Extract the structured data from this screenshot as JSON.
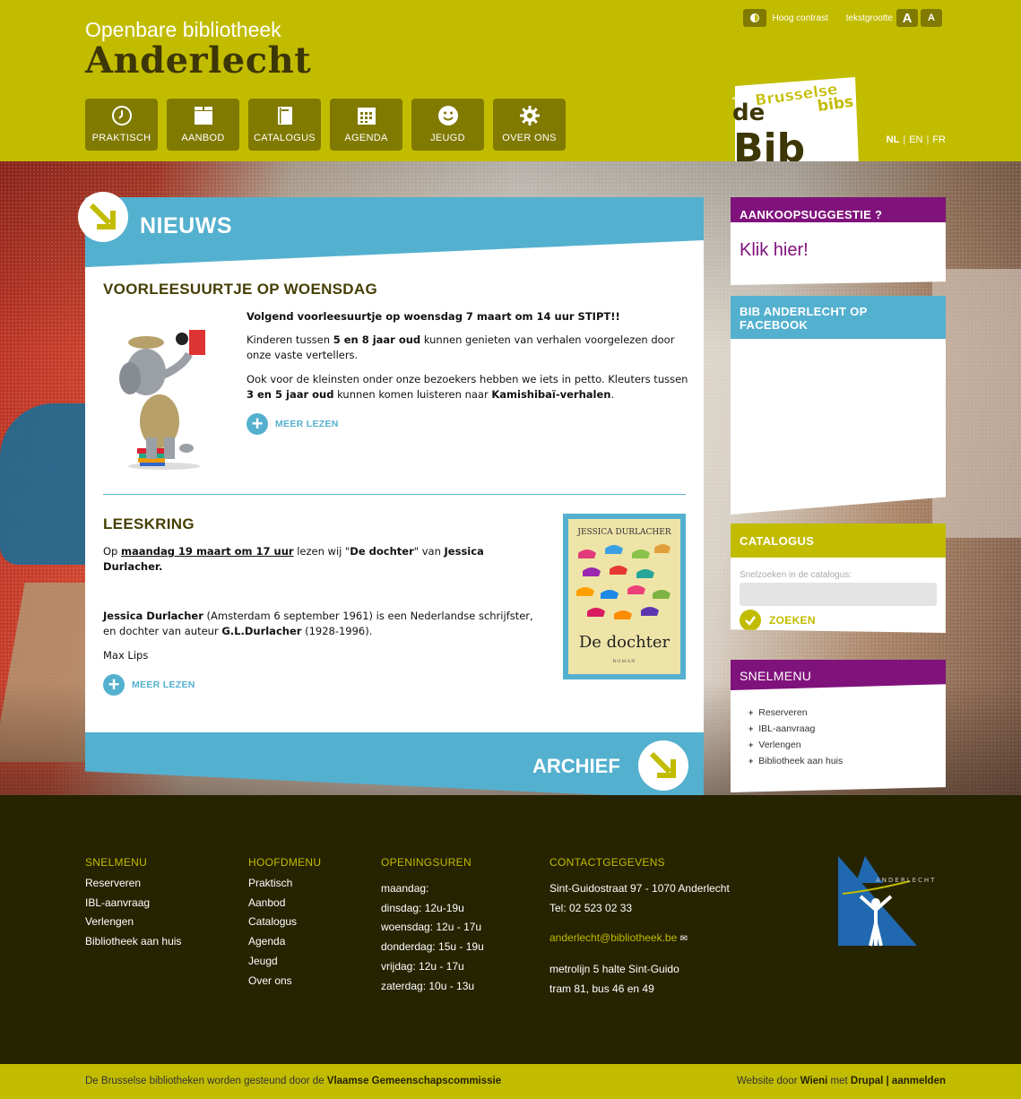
{
  "header": {
    "subtitle": "Openbare bibliotheek",
    "title": "Anderlecht",
    "nav": [
      {
        "label": "PRAKTISCH",
        "icon": "clock-icon"
      },
      {
        "label": "AANBOD",
        "icon": "box-icon"
      },
      {
        "label": "CATALOGUS",
        "icon": "book-icon"
      },
      {
        "label": "AGENDA",
        "icon": "calendar-icon"
      },
      {
        "label": "JEUGD",
        "icon": "smiley-icon"
      },
      {
        "label": "OVER ONS",
        "icon": "gear-icon"
      }
    ],
    "contrast_label": "Hoog contrast",
    "textsize_label": "tekstgrootte",
    "font_big": "A",
    "font_small": "A",
    "logo": {
      "top": "Brusselse",
      "bottom": "bibs",
      "de": "de",
      "bib": "Bib"
    },
    "languages": [
      "NL",
      "EN",
      "FR"
    ]
  },
  "news": {
    "title": "NIEUWS",
    "archive_label": "ARCHIEF",
    "articles": [
      {
        "title": "VOORLEESUURTJE OP WOENSDAG",
        "p1": "Volgend voorleesuurtje op woensdag 7 maart om 14 uur STIPT!!",
        "p2_pre": "Kinderen tussen ",
        "p2_bold": "5 en 8 jaar oud",
        "p2_post": " kunnen genieten van verhalen voorgelezen door onze vaste vertellers.",
        "p3_pre": "Ook voor de kleinsten onder onze bezoekers hebben we iets in petto. Kleuters tussen ",
        "p3_bold": "3 en 5 jaar oud",
        "p3_mid": " kunnen komen luisteren naar ",
        "p3_bold2": "Kamishibaï-verhalen",
        "p3_end": ".",
        "more": "MEER LEZEN"
      },
      {
        "title": "LEESKRING",
        "p1_pre": "Op ",
        "p1_link": "maandag 19 maart om 17 uur",
        "p1_mid": " lezen wij \"",
        "p1_bold": "De dochter",
        "p1_mid2": "\" van ",
        "p1_bold2": "Jessica Durlacher.",
        "p2_bold": "Jessica Durlacher",
        "p2_mid": " (Amsterdam 6 september 1961) is een Nederlandse schrijfster, en dochter van auteur ",
        "p2_bold2": "G.L.Durlacher",
        "p2_end": " (1928-1996).",
        "p3": "Max Lips",
        "more": "MEER LEZEN",
        "book_author": "JESSICA DURLACHER",
        "book_title": "De dochter",
        "book_sub": "ROMAN"
      }
    ]
  },
  "sidebar": {
    "suggest_title": "AANKOOPSUGGESTIE ?",
    "suggest_link": "Klik hier!",
    "facebook_title": "BIB ANDERLECHT OP FACEBOOK",
    "catalog_title": "CATALOGUS",
    "catalog_label": "Snelzoeken in de catalogus:",
    "catalog_placeholder": "",
    "search_button": "ZOEKEN",
    "snelmenu_title": "SNELMENU",
    "snelmenu_items": [
      "Reserveren",
      "IBL-aanvraag",
      "Verlengen",
      "Bibliotheek aan huis"
    ]
  },
  "footer": {
    "snelmenu": {
      "title": "SNELMENU",
      "items": [
        "Reserveren",
        "IBL-aanvraag",
        "Verlengen",
        "Bibliotheek aan huis"
      ]
    },
    "hoofdmenu": {
      "title": "HOOFDMENU",
      "items": [
        "Praktisch",
        "Aanbod",
        "Catalogus",
        "Agenda",
        "Jeugd",
        "Over ons"
      ]
    },
    "openingsuren": {
      "title": "OPENINGSUREN",
      "items": [
        "maandag:",
        "dinsdag: 12u-19u",
        "woensdag: 12u - 17u",
        "donderdag: 15u - 19u",
        "vrijdag: 12u - 17u",
        "zaterdag: 10u - 13u"
      ]
    },
    "contact": {
      "title": "CONTACTGEGEVENS",
      "address": "Sint-Guidostraat 97 - 1070 Anderlecht",
      "tel": "Tel: 02 523 02 33",
      "email": "anderlecht@bibliotheek.be",
      "transport1": "metrolijn 5 halte Sint-Guido",
      "transport2": "tram 81, bus 46 en 49"
    },
    "logo_text": "ANDERLECHT"
  },
  "bottom": {
    "left_pre": "De Brusselse bibliotheken worden gesteund door de ",
    "left_bold": "Vlaamse Gemeenschapscommissie",
    "right_pre": "Website door ",
    "right_wieni": "Wieni",
    "right_mid": " met ",
    "right_drupal": "Drupal",
    "right_sep": " | ",
    "right_login": "aanmelden"
  },
  "colors": {
    "olive": "#c2bc00",
    "dark_olive": "#807a00",
    "blue": "#54b0cf",
    "purple": "#80127c",
    "footer_bg": "#262300"
  }
}
